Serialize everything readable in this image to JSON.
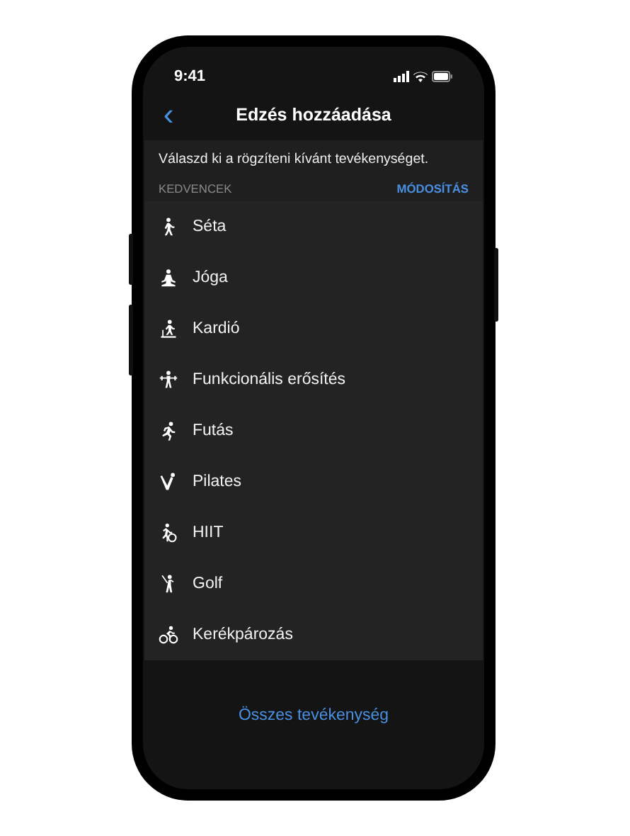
{
  "status_bar": {
    "time": "9:41"
  },
  "nav_bar": {
    "back": "‹",
    "title": "Edzés hozzáadása"
  },
  "subtitle": "Válaszd ki a rögzíteni kívánt tevékenységet.",
  "favorites": {
    "heading": "KEDVENCEK",
    "action": "MÓDOSÍTÁS",
    "items": [
      {
        "label": "Séta"
      },
      {
        "label": "Jóga"
      },
      {
        "label": "Kardió"
      },
      {
        "label": "Funkcionális erősítés"
      },
      {
        "label": "Futás"
      },
      {
        "label": "Pilates"
      },
      {
        "label": "HIIT"
      },
      {
        "label": "Golf"
      },
      {
        "label": "Kerékpározás"
      }
    ]
  },
  "footer_link": "Összes tevékenység"
}
